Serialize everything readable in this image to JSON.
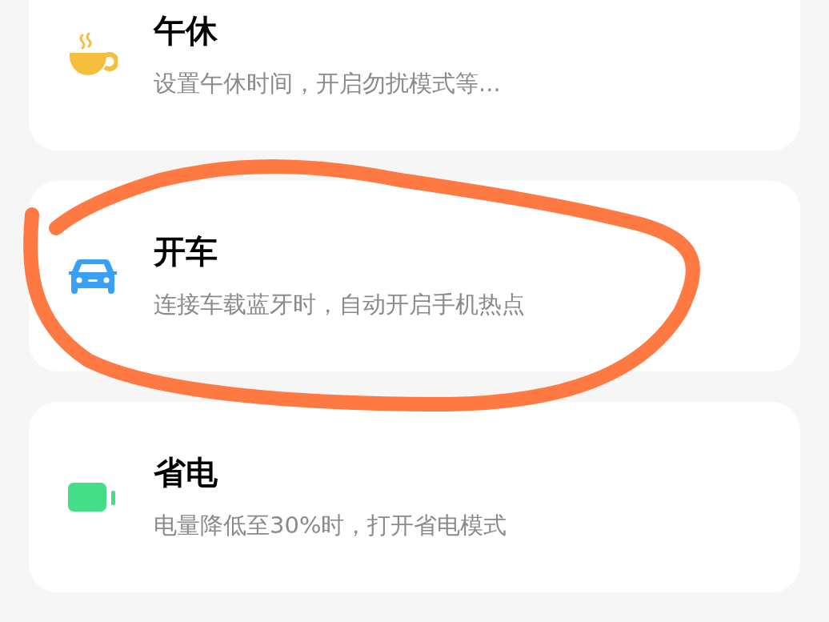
{
  "modes": [
    {
      "kind": "nap",
      "title": "午休",
      "subtitle": "设置午休时间，开启勿扰模式等...",
      "circled": false
    },
    {
      "kind": "drive",
      "title": "开车",
      "subtitle": "连接车载蓝牙时，自动开启手机热点",
      "circled": true
    },
    {
      "kind": "power",
      "title": "省电",
      "subtitle": "电量降低至30%时，打开省电模式",
      "circled": false
    }
  ]
}
